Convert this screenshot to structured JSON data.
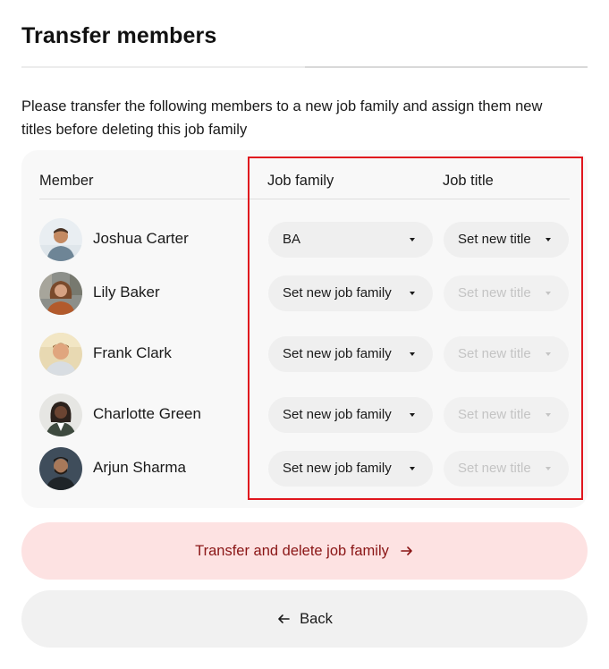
{
  "dialog": {
    "title": "Transfer members",
    "description": "Please transfer the following members to a new job family and assign them new titles before deleting this job family"
  },
  "table": {
    "headers": {
      "member": "Member",
      "job_family": "Job family",
      "job_title": "Job title"
    },
    "rows": [
      {
        "name": "Joshua Carter",
        "job_family": "BA",
        "job_title": "Set new title",
        "title_enabled": true
      },
      {
        "name": "Lily Baker",
        "job_family": "Set new job family",
        "job_title": "Set new title",
        "title_enabled": false
      },
      {
        "name": "Frank Clark",
        "job_family": "Set new job family",
        "job_title": "Set new title",
        "title_enabled": false
      },
      {
        "name": "Charlotte Green",
        "job_family": "Set new job family",
        "job_title": "Set new title",
        "title_enabled": false
      },
      {
        "name": "Arjun Sharma",
        "job_family": "Set new job family",
        "job_title": "Set new title",
        "title_enabled": false
      }
    ]
  },
  "actions": {
    "primary_label": "Transfer and delete job family",
    "primary_icon": "arrow-right-icon",
    "secondary_label": "Back",
    "secondary_icon": "arrow-left-icon"
  },
  "colors": {
    "primary_bg": "#fde2e2",
    "primary_text": "#8a1515",
    "highlight_border": "#e0161e"
  }
}
